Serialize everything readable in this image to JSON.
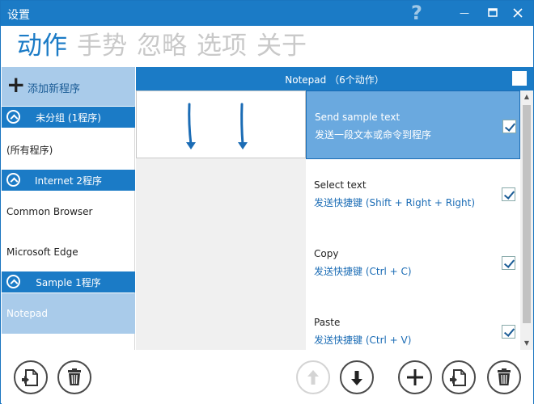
{
  "window": {
    "title": "设置",
    "help_glyph": "?",
    "minimize_glyph": "—",
    "maximize_glyph": "☐",
    "close_glyph": "✕"
  },
  "tabs": [
    {
      "label": "动作",
      "active": true
    },
    {
      "label": "手势",
      "active": false
    },
    {
      "label": "忽略",
      "active": false
    },
    {
      "label": "选项",
      "active": false
    },
    {
      "label": "关于",
      "active": false
    }
  ],
  "sidebar": {
    "add_program_label": "添加新程序",
    "groups": [
      {
        "label": "未分组 (1程序)",
        "items": [
          "(所有程序)"
        ]
      },
      {
        "label": "Internet 2程序",
        "items": [
          "Common Browser",
          "Microsoft Edge"
        ]
      },
      {
        "label": "Sample 1程序",
        "items": [
          "Notepad"
        ]
      }
    ],
    "selected_item": "Notepad"
  },
  "actions_panel": {
    "header": "Notepad （6个动作）",
    "actions": [
      {
        "name": "Send sample text",
        "description": "发送一段文本或命令到程序",
        "checked": true,
        "selected": true
      },
      {
        "name": "Select text",
        "description": "发送快捷键 (Shift + Right + Right)",
        "checked": true,
        "selected": false
      },
      {
        "name": "Copy",
        "description": "发送快捷键 (Ctrl + C)",
        "checked": true,
        "selected": false
      },
      {
        "name": "Paste",
        "description": "发送快捷键 (Ctrl + V)",
        "checked": true,
        "selected": false
      }
    ]
  },
  "colors": {
    "accent": "#1b7bc6",
    "selection": "#6aa9df",
    "sidebar_selection": "#a9cbea",
    "inactive_tab": "#c9c9c9"
  },
  "bottom_toolbar": {
    "left": [
      "import-icon",
      "delete-icon"
    ],
    "right": [
      "move-up-icon",
      "move-down-icon",
      "add-icon",
      "import-icon",
      "delete-icon"
    ],
    "move_up_enabled": false
  }
}
